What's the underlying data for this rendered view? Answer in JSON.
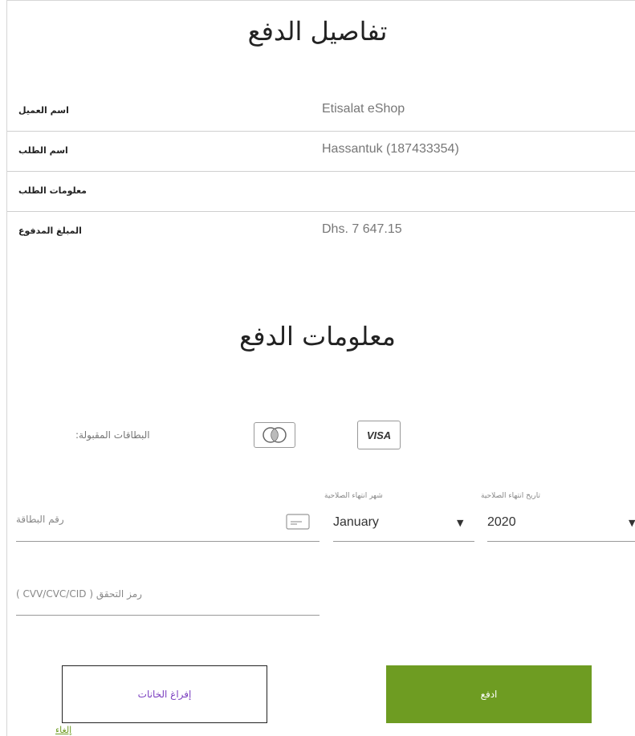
{
  "payment_details": {
    "title": "تفاصيل الدفع",
    "rows": [
      {
        "label": "اسم العميل",
        "value": "Etisalat eShop"
      },
      {
        "label": "اسم الطلب",
        "value": "Hassantuk (187433354)"
      },
      {
        "label": "معلومات الطلب",
        "value": ""
      },
      {
        "label": "المبلغ المدفوع",
        "value": "Dhs. 7 647.15"
      }
    ]
  },
  "payment_info": {
    "title": "معلومات الدفع",
    "accepted_cards_label": ":البطاقات المقبولة",
    "cards": [
      "visa-icon",
      "mastercard-icon"
    ],
    "visa_text": "VISA",
    "card_number_placeholder": "رقم البطاقة",
    "expiry_month_label": "شهر انتهاء الصلاحية",
    "expiry_month_value": "January",
    "expiry_year_label": "تاريخ انتهاء الصلاحية",
    "expiry_year_value": "2020",
    "cvv_placeholder": "( CVV/CVC/CID ) رمز التحقق"
  },
  "actions": {
    "clear_label": "إفراغ الخانات",
    "pay_label": "ادفع",
    "cancel_label": "إلغاء"
  },
  "colors": {
    "accent": "#6e9c22",
    "clear_text": "#7b3fbf"
  }
}
